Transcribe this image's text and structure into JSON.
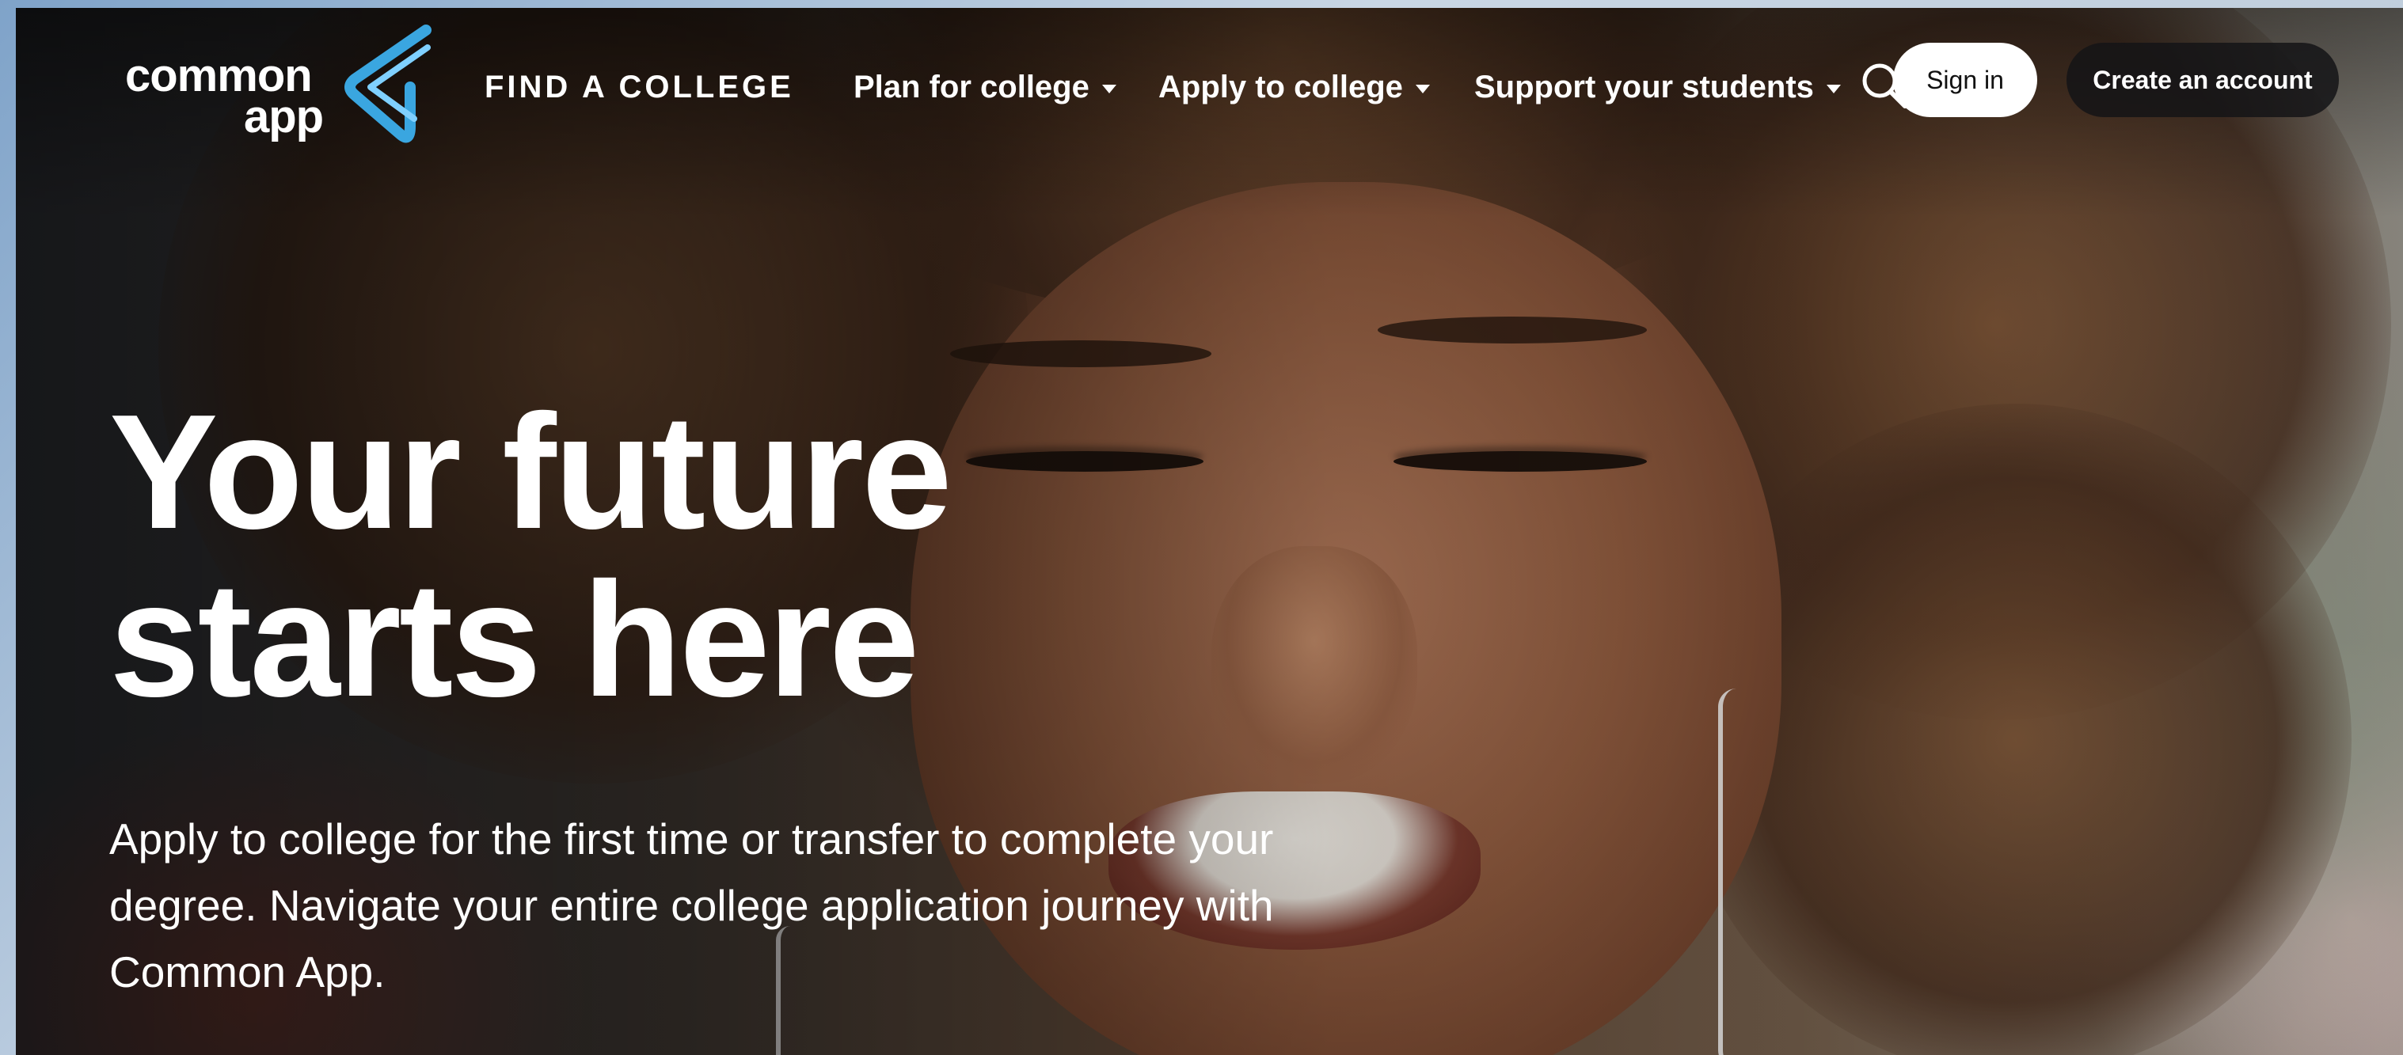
{
  "logo": {
    "line1": "common",
    "line2": "app",
    "brand_color": "#3aa6e0"
  },
  "nav": {
    "find": "FIND A COLLEGE",
    "plan": "Plan for college",
    "apply": "Apply to college",
    "support": "Support your students"
  },
  "actions": {
    "search_icon": "search-icon",
    "signin": "Sign in",
    "create": "Create an account"
  },
  "hero": {
    "headline_line1": "Your future",
    "headline_line2": "starts here",
    "subtext": "Apply to college for the first time or transfer to complete your degree. Navigate your entire college application journey with Common App."
  }
}
